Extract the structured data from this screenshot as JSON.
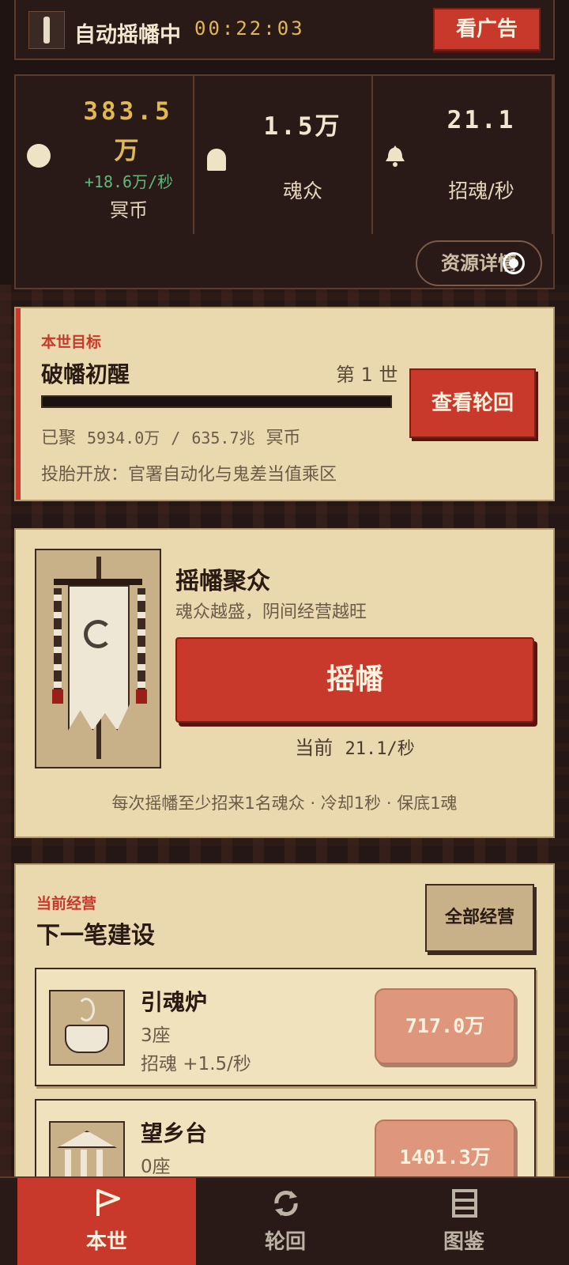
{
  "topbar": {
    "title": "自动摇幡中",
    "timer": "00:22:03",
    "ad_button": "看广告"
  },
  "stats": {
    "coins": {
      "value": "383.5",
      "unit": "万",
      "rate": "+18.6万/秒",
      "label": "冥币"
    },
    "souls": {
      "value": "1.5万",
      "label": "魂众"
    },
    "summon_rate": {
      "value": "21.1",
      "label": "招魂/秒"
    },
    "detail_button": "资源详情"
  },
  "goal": {
    "tag": "本世目标",
    "name": "破幡初醒",
    "generation": "第 1 世",
    "progress_fraction": 0.0,
    "progress_prefix": "已聚",
    "progress_current": "5934.0万",
    "progress_sep": "/",
    "progress_target": "635.7兆",
    "progress_unit": "冥币",
    "unlock_text": "投胎开放：官署自动化与鬼差当值乘区",
    "reincarnation_button": "查看轮回"
  },
  "banner": {
    "title": "摇幡聚众",
    "subtitle": "魂众越盛，阴间经营越旺",
    "shake_button": "摇幡",
    "current_prefix": "当前",
    "current_rate": "21.1/秒",
    "note": "每次摇幡至少招来1名魂众 · 冷却1秒 · 保底1魂"
  },
  "build": {
    "tag": "当前经营",
    "title": "下一笔建设",
    "all_button": "全部经营",
    "items": [
      {
        "name": "引魂炉",
        "count": "3座",
        "rate": "招魂 +1.5/秒",
        "price": "717.0万",
        "icon": "incense-burner-icon"
      },
      {
        "name": "望乡台",
        "count": "0座",
        "rate": "",
        "price": "1401.3万",
        "icon": "pavilion-icon"
      }
    ]
  },
  "nav": {
    "tabs": [
      {
        "label": "本世",
        "icon": "flag-icon"
      },
      {
        "label": "轮回",
        "icon": "cycle-icon"
      },
      {
        "label": "图鉴",
        "icon": "list-icon"
      }
    ],
    "active": 0
  },
  "colors": {
    "accent": "#c8382b",
    "gold": "#e0b954",
    "green": "#62b67c",
    "parchment": "#ead9ae",
    "dark": "#2a1a17"
  }
}
